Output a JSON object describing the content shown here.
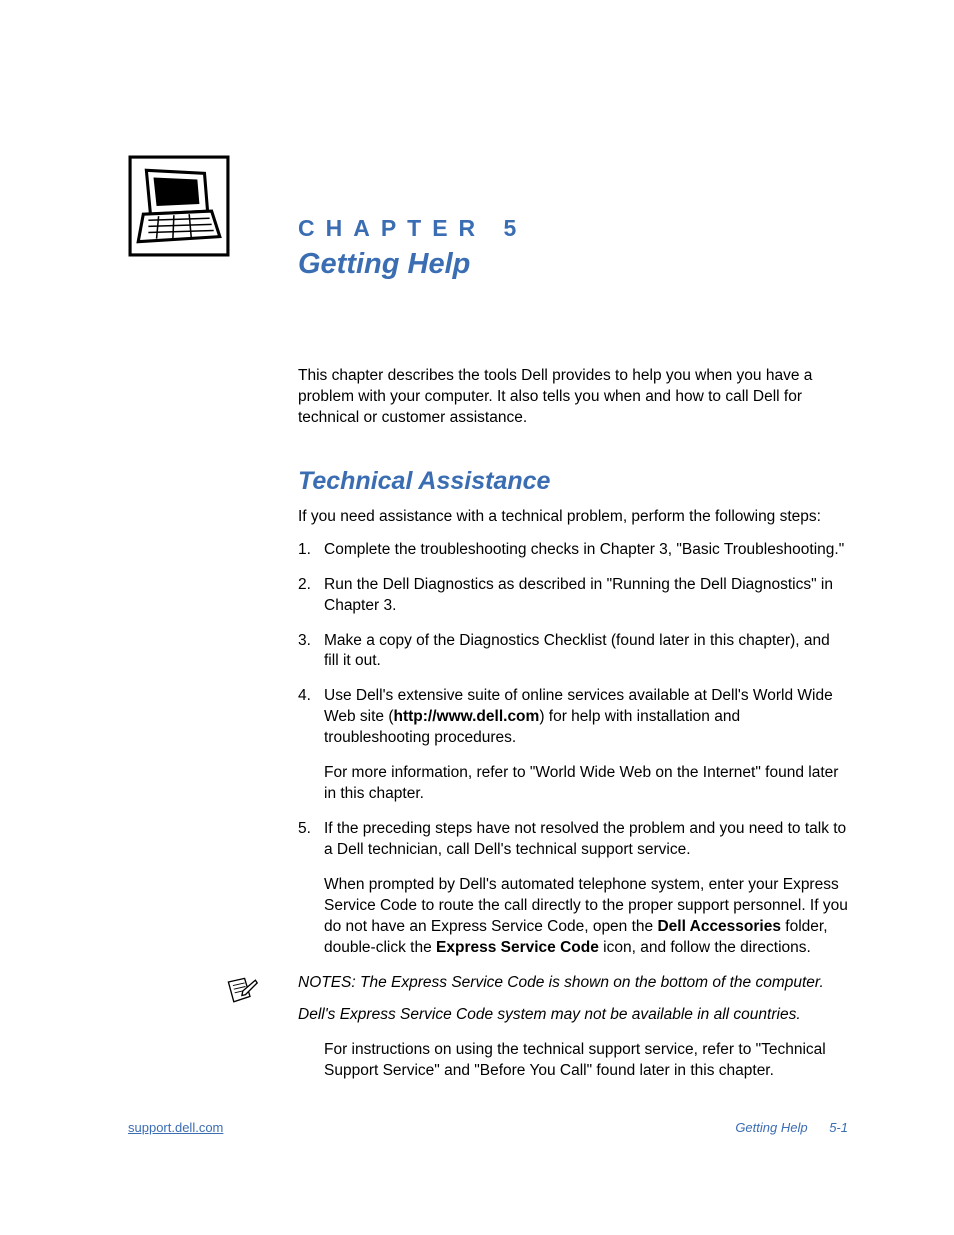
{
  "header": {
    "chapter_label": "CHAPTER 5",
    "chapter_title": "Getting Help"
  },
  "intro": "This chapter describes the tools Dell provides to help you when you have a problem with your computer. It also tells you when and how to call Dell for technical or customer assistance.",
  "section": {
    "heading": "Technical Assistance",
    "intro": "If you need assistance with a technical problem, perform the following steps:",
    "steps": [
      {
        "num": "1.",
        "paras": [
          "Complete the troubleshooting checks in Chapter 3, \"Basic Troubleshooting.\""
        ]
      },
      {
        "num": "2.",
        "paras": [
          "Run the Dell Diagnostics as described in \"Running the Dell Diagnostics\" in Chapter 3."
        ]
      },
      {
        "num": "3.",
        "paras": [
          "Make a copy of the Diagnostics Checklist (found later in this chapter), and fill it out."
        ]
      },
      {
        "num": "4.",
        "paras_rich": [
          {
            "segments": [
              {
                "t": "Use Dell's extensive suite of online services available at Dell's World Wide Web site ("
              },
              {
                "t": "http://www.dell.com",
                "b": true
              },
              {
                "t": ") for help with installation and troubleshooting procedures."
              }
            ]
          },
          {
            "segments": [
              {
                "t": "For more information, refer to \"World Wide Web on the Internet\" found later in this chapter."
              }
            ]
          }
        ]
      },
      {
        "num": "5.",
        "paras_rich": [
          {
            "segments": [
              {
                "t": "If the preceding steps have not resolved the problem and you need to talk to a Dell technician, call Dell's technical support service."
              }
            ]
          },
          {
            "segments": [
              {
                "t": "When prompted by Dell's automated telephone system, enter your Express Service Code to route the call directly to the proper support personnel. If you do not have an Express Service Code, open the "
              },
              {
                "t": "Dell Accessories",
                "b": true
              },
              {
                "t": " folder, double-click the "
              },
              {
                "t": "Express Service Code",
                "b": true
              },
              {
                "t": " icon, and follow the directions."
              }
            ]
          }
        ]
      }
    ],
    "notes": [
      "NOTES: The Express Service Code is shown on the bottom of the computer.",
      "Dell's Express Service Code system may not be available in all countries."
    ],
    "tail": "For instructions on using the technical support service, refer to \"Technical Support Service\" and \"Before You Call\" found later in this chapter."
  },
  "footer": {
    "left": "support.dell.com",
    "right_label": "Getting Help",
    "right_page": "5-1"
  }
}
